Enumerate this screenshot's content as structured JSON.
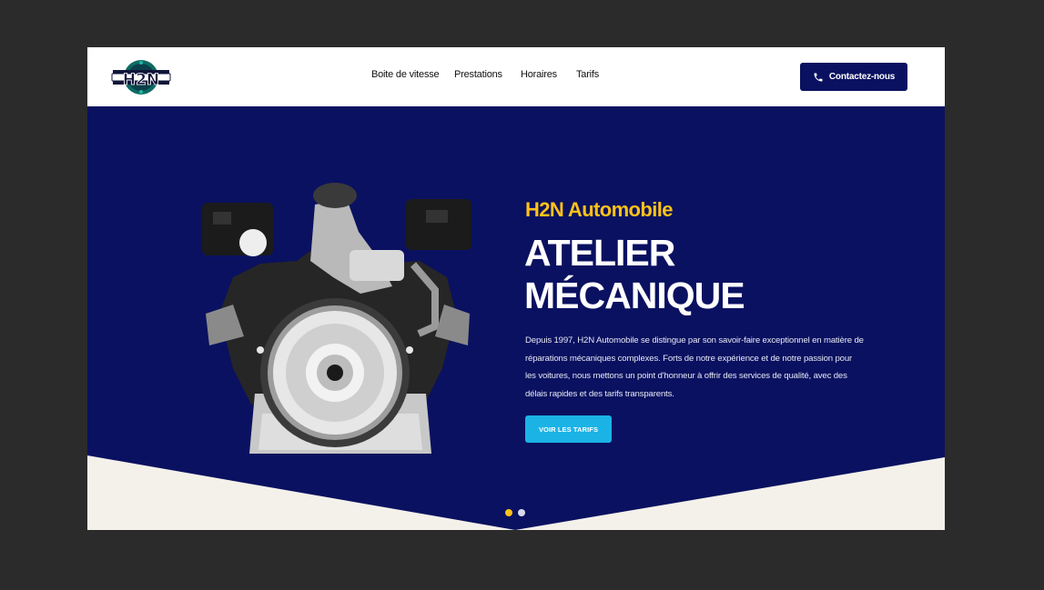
{
  "header": {
    "logo_text": "H2N",
    "nav": [
      "Boite de vitesse",
      "Prestations",
      "Horaires",
      "Tarifs"
    ],
    "contact_label": "Contactez-nous"
  },
  "hero": {
    "brand": "H2N Automobile",
    "title_line1": "ATELIER",
    "title_line2": "MÉCANIQUE",
    "description": "Depuis 1997, H2N Automobile se distingue par son savoir-faire exceptionnel en matière de réparations mécaniques complexes. Forts de notre expérience et de notre passion pour les voitures, nous mettons un point d'honneur à offrir des services de qualité, avec des délais rapides et des tarifs transparents.",
    "cta_label": "VOIR LES TARIFS",
    "slider": {
      "total": 2,
      "active": 1
    }
  },
  "colors": {
    "navy": "#0a1160",
    "accent_yellow": "#ffc21a",
    "cta_blue": "#1bb3e6",
    "cream": "#f4f1ea"
  }
}
